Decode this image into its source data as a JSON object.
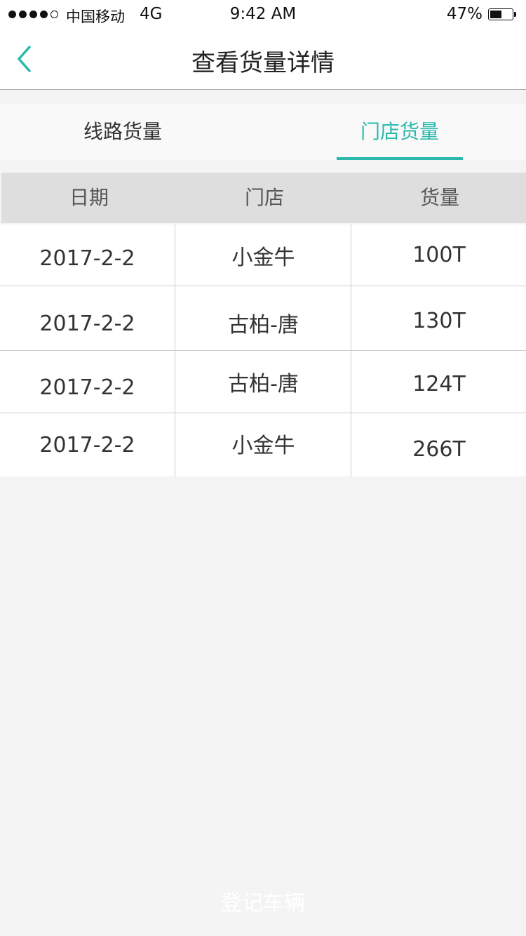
{
  "status_bar": {
    "carrier": "中国移动",
    "network": "4G",
    "time": "9:42 AM",
    "battery": "47%",
    "battery_level": 0.47
  },
  "nav": {
    "title": "查看货量详情",
    "back_icon": "chevron-left-icon"
  },
  "tabs": [
    {
      "label": "线路货量",
      "active": false
    },
    {
      "label": "门店货量",
      "active": true
    }
  ],
  "table": {
    "headers": [
      "日期",
      "门店",
      "货量"
    ],
    "rows": [
      {
        "date": "2017-2-2",
        "store": "小金牛",
        "qty": "100T"
      },
      {
        "date": "2017-2-2",
        "store": "古柏-唐",
        "qty": "130T"
      },
      {
        "date": "2017-2-2",
        "store": "古柏-唐",
        "qty": "124T"
      },
      {
        "date": "2017-2-2",
        "store": "小金牛",
        "qty": "266T"
      }
    ]
  },
  "bottom_button": {
    "label": "登记车辆"
  },
  "colors": {
    "accent": "#2bb9ad",
    "page_bg": "#f4f4f4",
    "header_bg": "#dedede"
  }
}
